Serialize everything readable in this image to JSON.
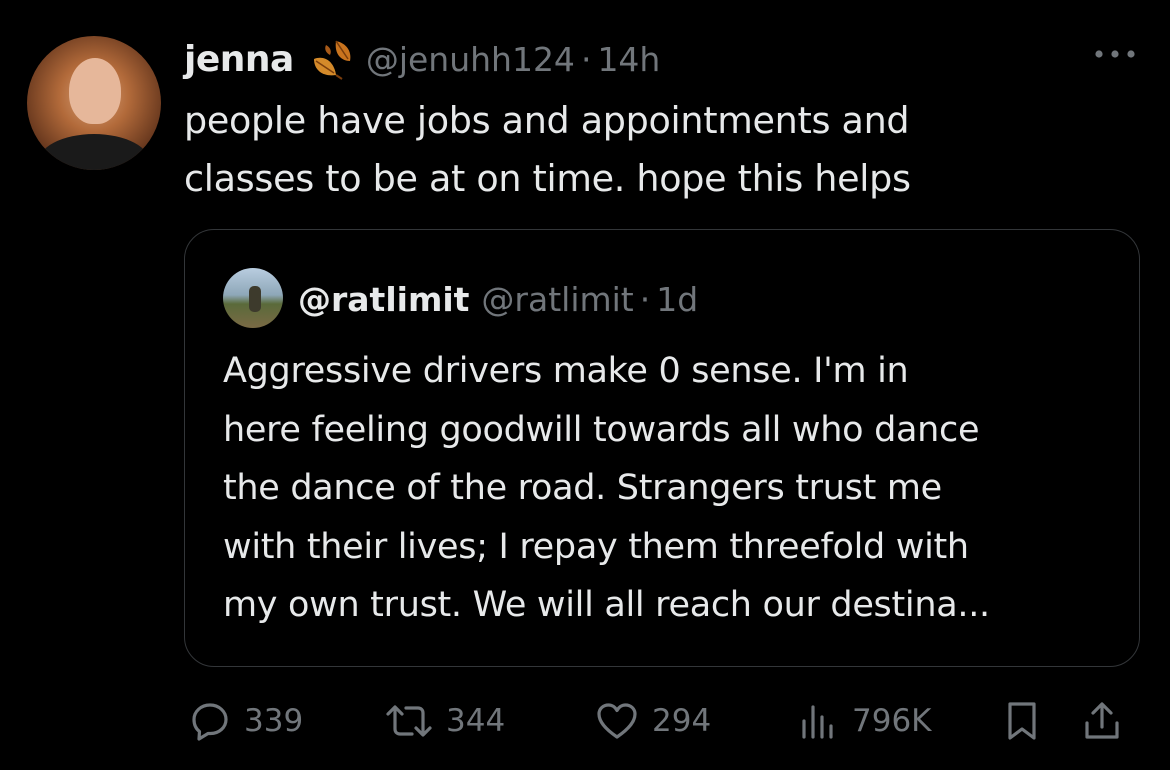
{
  "tweet": {
    "author_name": "jenna",
    "author_handle": "@jenuhh124",
    "separator": "·",
    "time": "14h",
    "text_line1": "people have jobs and appointments and",
    "text_line2": "classes to be at on time. hope this helps",
    "emoji_icon": "autumn-leaves-icon"
  },
  "quote": {
    "author_name": "@ratlimit",
    "author_handle": "@ratlimit",
    "separator": "·",
    "time": "1d",
    "text_lines": [
      "Aggressive drivers make 0 sense. I'm in",
      "here feeling goodwill towards all who dance",
      "the dance of the road. Strangers trust me",
      "with their lives; I repay them threefold with",
      "my own trust. We will all reach our destina..."
    ]
  },
  "actions": {
    "replies": "339",
    "reposts": "344",
    "likes": "294",
    "views": "796K"
  },
  "colors": {
    "background": "#000000",
    "text": "#e7e9ea",
    "muted": "#71767b",
    "border": "#333639",
    "leaf": "#c9741e"
  }
}
